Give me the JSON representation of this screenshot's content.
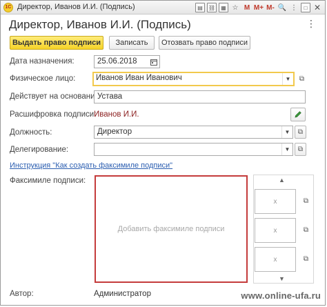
{
  "window": {
    "title": "Директор, Иванов И.И. (Подпись)",
    "app_logo": "1С",
    "toolbar_icons": [
      "document-icon",
      "link-icon",
      "calendar-icon",
      "star-icon"
    ],
    "mem_buttons": [
      "M",
      "M+",
      "M-"
    ],
    "extra_icons": [
      "zoom-icon",
      "menu-icon",
      "maximize-icon",
      "close-icon"
    ]
  },
  "header": {
    "title": "Директор, Иванов И.И. (Подпись)",
    "more": "⋮"
  },
  "actions": {
    "grant": "Выдать право подписи",
    "save": "Записать",
    "revoke": "Отозвать право подписи"
  },
  "form": {
    "date_label": "Дата назначения:",
    "date_value": "25.06.2018",
    "person_label": "Физическое лицо:",
    "person_value": "Иванов Иван Иванович",
    "basis_label": "Действует на основании:",
    "basis_value": "Устава",
    "decode_label": "Расшифровка подписи:",
    "decode_value": "Иванов И.И.",
    "position_label": "Должность:",
    "position_value": "Директор",
    "delegation_label": "Делегирование:",
    "delegation_value": ""
  },
  "link": {
    "text": "Инструкция \"Как создать факсимиле подписи\""
  },
  "facsimile": {
    "label": "Факсимиле подписи:",
    "placeholder": "Добавить факсимиле подписи",
    "thumb_marks": [
      "x",
      "x",
      "x"
    ]
  },
  "author": {
    "label": "Автор:",
    "value": "Администратор"
  },
  "watermark": "www.online-ufa.ru",
  "colors": {
    "primary_button": "#f5d328",
    "focus_border": "#f2c94c",
    "facsimile_border": "#c43a3a",
    "link": "#2a5db0",
    "decode_text": "#8b1f1f"
  }
}
